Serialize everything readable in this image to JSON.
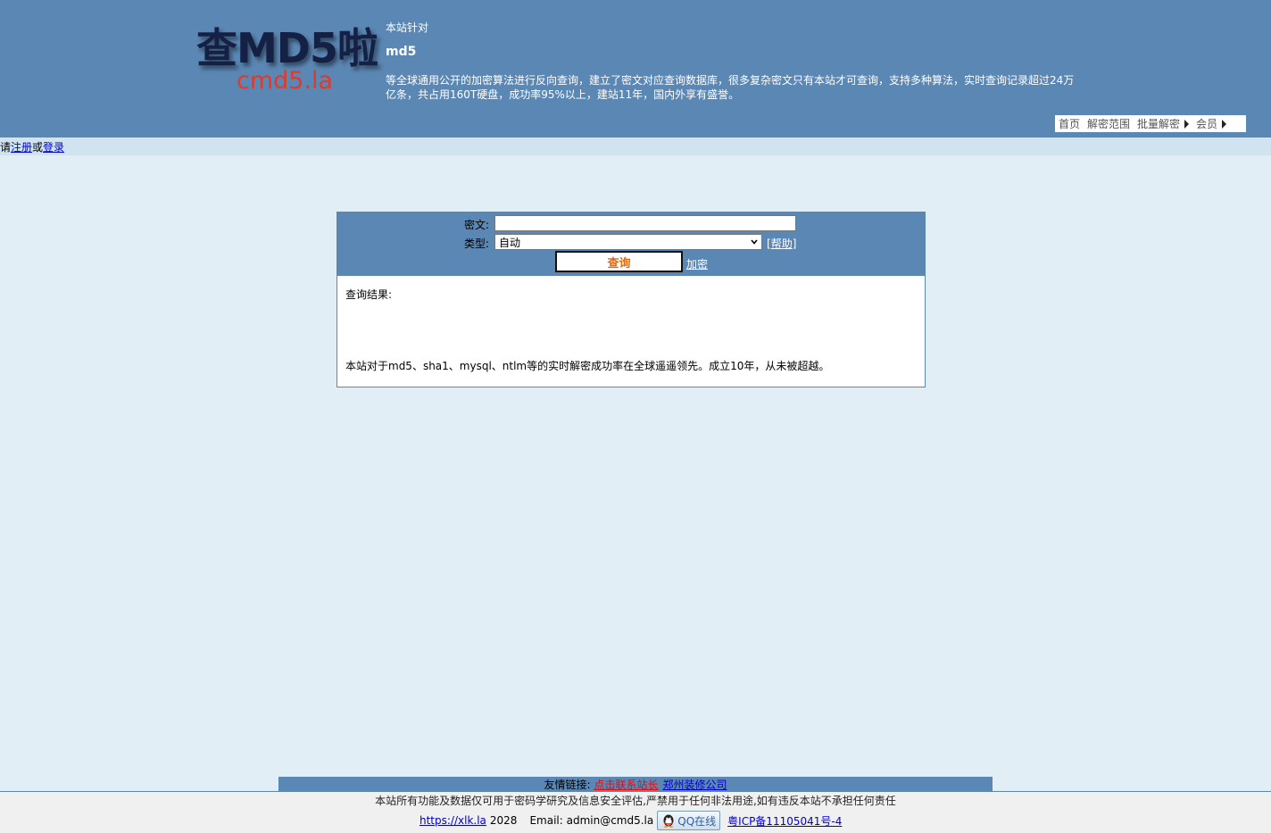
{
  "header": {
    "logo_main": "查MD5啦",
    "logo_sub": "cmd5.la",
    "intro_line1": "本站针对",
    "intro_line2": "md5",
    "intro_line3": "等全球通用公开的加密算法进行反向查询，建立了密文对应查询数据库，很多复杂密文只有本站才可查询，支持多种算法，实时查询记录超过24万亿条，共占用160T硬盘，成功率95%以上，建站11年，国内外享有盛誉。"
  },
  "nav": {
    "items": [
      {
        "label": "首页"
      },
      {
        "label": "解密范围"
      },
      {
        "label": "批量解密"
      },
      {
        "label": "会员"
      }
    ]
  },
  "login": {
    "prefix": "请",
    "register": "注册",
    "or": "或",
    "login": "登录"
  },
  "query": {
    "cipher_label": "密文:",
    "cipher_value": "",
    "type_label": "类型:",
    "type_selected": "自动",
    "help_open": "[",
    "help_label": "帮助",
    "help_close": "]",
    "submit_label": "查询",
    "encrypt_label": "加密",
    "result_label": "查询结果:",
    "note": "本站对于md5、sha1、mysql、ntlm等的实时解密成功率在全球遥遥领先。成立10年，从未被超越。"
  },
  "footer": {
    "friend_label": "友情链接:",
    "friend_link_1": "点击联系站长",
    "friend_link_2": "郑州装修公司",
    "disclaimer": "本站所有功能及数据仅可用于密码学研究及信息安全评估,严禁用于任何非法用途,如有违反本站不承担任何责任",
    "site_link": "https://xlk.la",
    "year": "2028",
    "email": "Email: admin@cmd5.la",
    "qq_label": "QQ在线",
    "icp": "粤ICP备11105041号-4"
  },
  "colors": {
    "header_bg": "#5b87b4",
    "page_bg": "#e1eef6",
    "logo_main": "#152045",
    "logo_sub": "#e03a2c",
    "submit_text": "#e06a10"
  }
}
